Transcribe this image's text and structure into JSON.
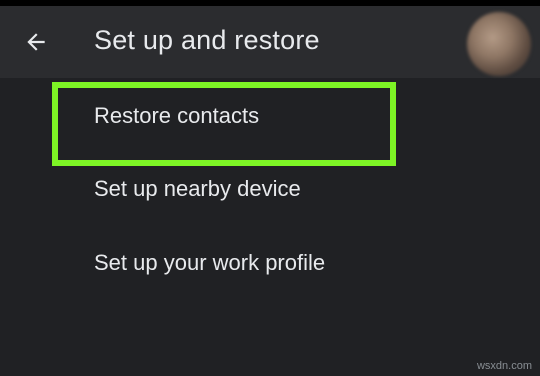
{
  "app_bar": {
    "title": "Set up and restore",
    "back_icon": "arrow-back-icon"
  },
  "menu": {
    "items": [
      {
        "label": "Restore contacts",
        "highlighted": true
      },
      {
        "label": "Set up nearby device",
        "highlighted": false
      },
      {
        "label": "Set up your work profile",
        "highlighted": false
      }
    ]
  },
  "annotation": {
    "highlight_color": "#7df425"
  },
  "watermark": "wsxdn.com",
  "colors": {
    "background": "#202124",
    "app_bar": "#2b2c2f",
    "text": "#e8eaed"
  }
}
